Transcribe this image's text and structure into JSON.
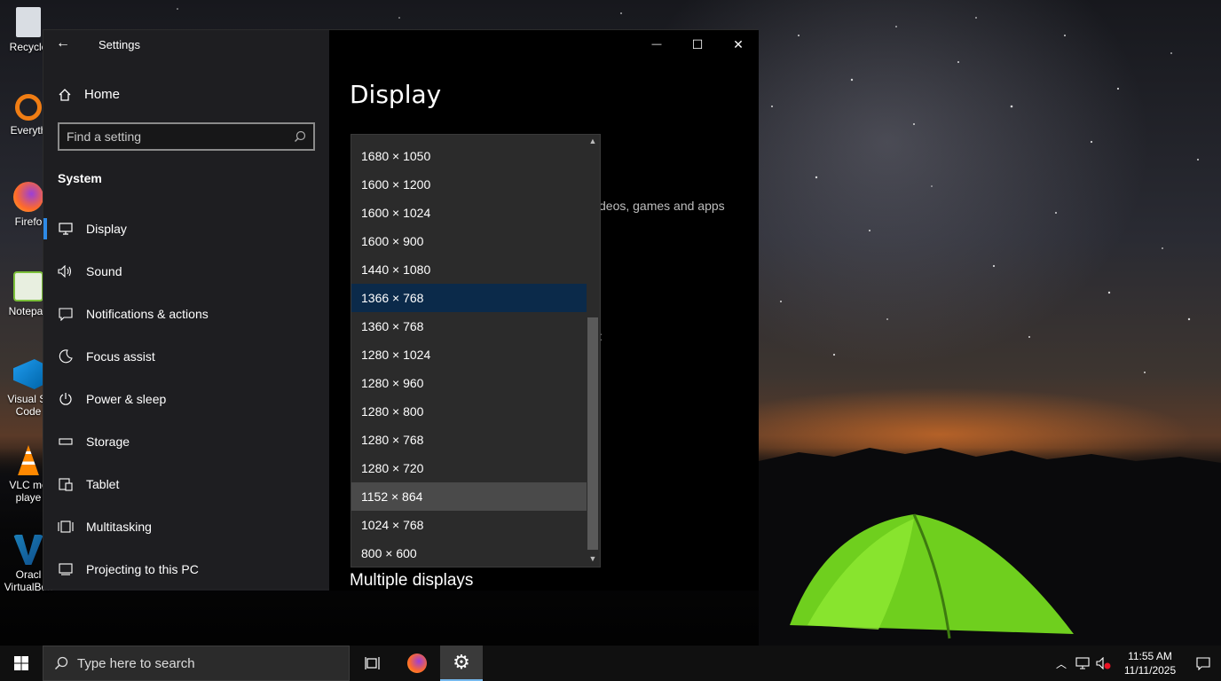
{
  "desktop": {
    "icons": [
      {
        "label": "Recycle",
        "icon": "recycle-bin-icon"
      },
      {
        "label": "Everyth",
        "icon": "everything-icon"
      },
      {
        "label": "Firefo",
        "icon": "firefox-icon"
      },
      {
        "label": "Notepac",
        "icon": "notepad-plus-icon"
      },
      {
        "label": "Visual St\nCode",
        "icon": "vscode-icon"
      },
      {
        "label": "VLC me\nplaye",
        "icon": "vlc-icon"
      },
      {
        "label": "Oracl\nVirtualBox",
        "icon": "virtualbox-icon"
      }
    ]
  },
  "settings": {
    "title": "Settings",
    "home_label": "Home",
    "search_placeholder": "Find a setting",
    "section": "System",
    "nav": [
      {
        "label": "Display",
        "icon": "monitor-icon",
        "active": true
      },
      {
        "label": "Sound",
        "icon": "speaker-icon"
      },
      {
        "label": "Notifications & actions",
        "icon": "notification-icon"
      },
      {
        "label": "Focus assist",
        "icon": "moon-icon"
      },
      {
        "label": "Power & sleep",
        "icon": "power-icon"
      },
      {
        "label": "Storage",
        "icon": "storage-icon"
      },
      {
        "label": "Tablet",
        "icon": "tablet-icon"
      },
      {
        "label": "Multitasking",
        "icon": "multitasking-icon"
      },
      {
        "label": "Projecting to this PC",
        "icon": "projecting-icon"
      }
    ],
    "page_title": "Display",
    "background_text": "deos, games and apps",
    "background_colon": ":",
    "section_heading": "Multiple displays",
    "resolution_options": [
      "1680 × 1050",
      "1600 × 1200",
      "1600 × 1024",
      "1600 × 900",
      "1440 × 1080",
      "1366 × 768",
      "1360 × 768",
      "1280 × 1024",
      "1280 × 960",
      "1280 × 800",
      "1280 × 768",
      "1280 × 720",
      "1152 × 864",
      "1024 × 768",
      "800 × 600"
    ],
    "selected_resolution": "1366 × 768",
    "hovered_resolution": "1152 × 864",
    "caption_buttons": {
      "minimize": "—",
      "maximize": "☐",
      "close": "✕"
    }
  },
  "taskbar": {
    "search_placeholder": "Type here to search",
    "time": "11:55 AM",
    "date": "11/11/2025",
    "accent": "#76b9ed"
  }
}
